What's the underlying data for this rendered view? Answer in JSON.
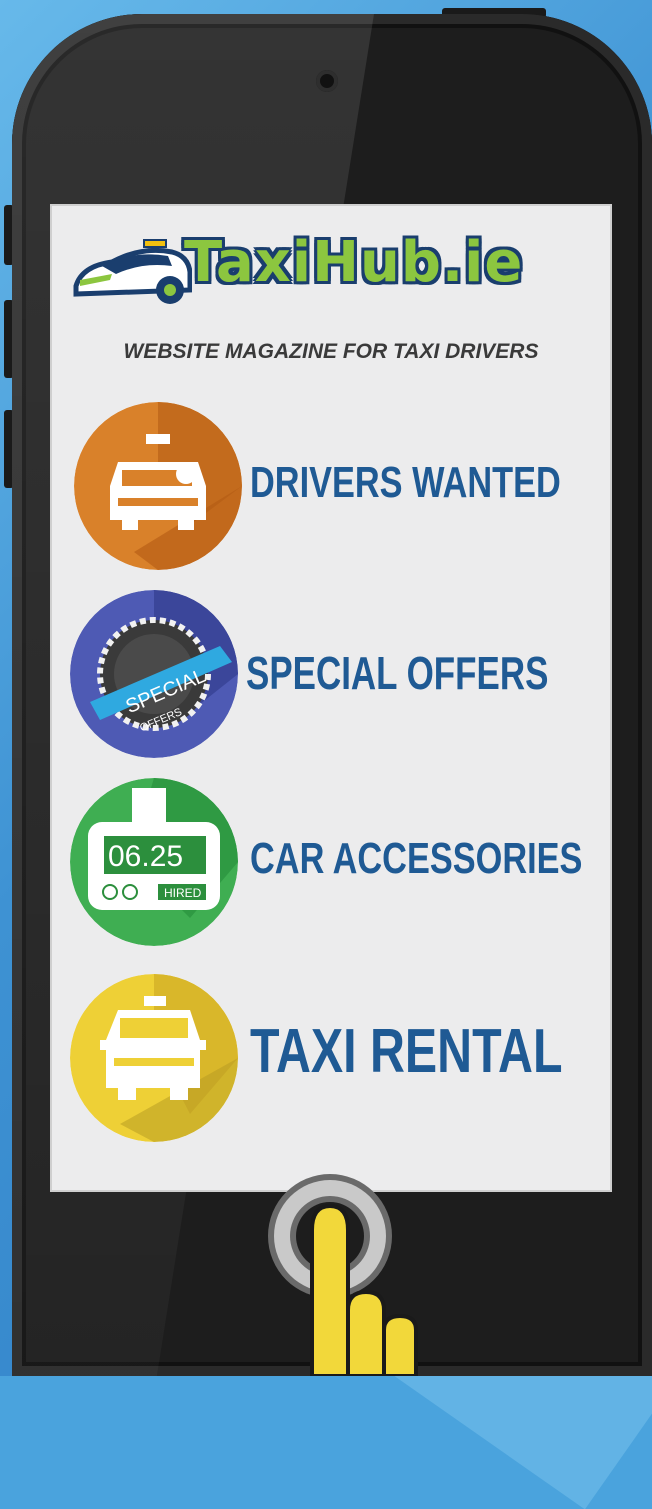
{
  "brand": {
    "logo_text": "TaxiHub.ie"
  },
  "tagline": "WEBSITE MAGAZINE FOR TAXI DRIVERS",
  "menu": [
    {
      "label": "DRIVERS WANTED",
      "icon": "taxi-driver-icon",
      "color": "#c9711f"
    },
    {
      "label": "SPECIAL OFFERS",
      "icon": "special-offers-badge-icon",
      "color": "#3e4aa1",
      "badge_top": "SPECIAL",
      "badge_bottom": "OFFERS"
    },
    {
      "label": "CAR ACCESSORIES",
      "icon": "taxi-meter-icon",
      "color": "#36a24a",
      "meter_value": "06.25",
      "meter_status": "HIRED"
    },
    {
      "label": "TAXI RENTAL",
      "icon": "taxi-car-icon",
      "color": "#e7c52c"
    }
  ],
  "colors": {
    "label_blue": "#1f5a94",
    "logo_green": "#8cc63f",
    "logo_outline": "#1a3e6e"
  }
}
